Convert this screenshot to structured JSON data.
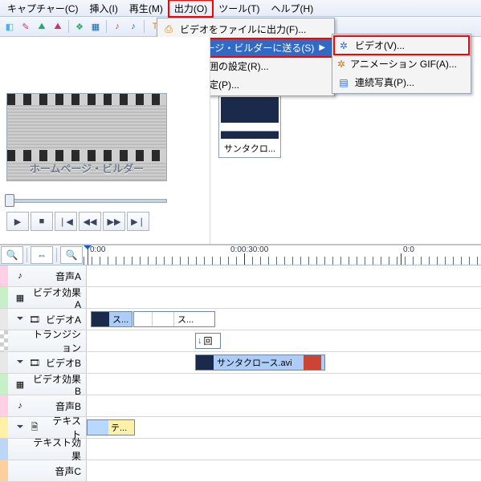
{
  "menu": {
    "capture": "キャプチャー(C)",
    "insert": "挿入(I)",
    "play": "再生(M)",
    "output": "出力(O)",
    "tool": "ツール(T)",
    "help": "ヘルプ(H)"
  },
  "output_menu": {
    "to_file": "ビデオをファイルに出力(F)...",
    "send_hp_builder": "ホームページ・ビルダーに送る(S)",
    "range_settings": "出力範囲の設定(R)...",
    "output_settings": "出力設定(P)..."
  },
  "submenu": {
    "video": "ビデオ(V)...",
    "anim_gif": "アニメーション GIF(A)...",
    "sequence": "連続写真(P)..."
  },
  "preview": {
    "placeholder": "ホームページ・ビルダー"
  },
  "clip": {
    "caption": "サンタクロ..."
  },
  "ruler": {
    "t1": "0:00",
    "t2": "0:00:30:00",
    "t3": "0:0"
  },
  "tracks": {
    "audioA": "音声A",
    "vfxA": "ビデオ効果A",
    "videoA": "ビデオA",
    "transition": "トランジション",
    "videoB": "ビデオB",
    "vfxB": "ビデオ効果B",
    "audioB": "音声B",
    "text": "テキスト",
    "textfx": "テキスト効果",
    "audioC": "音声C"
  },
  "clips": {
    "videoA1": "ス...",
    "videoA2": "ス...",
    "trans": "回",
    "videoB": "サンタクロース.avi",
    "text": "テ..."
  }
}
